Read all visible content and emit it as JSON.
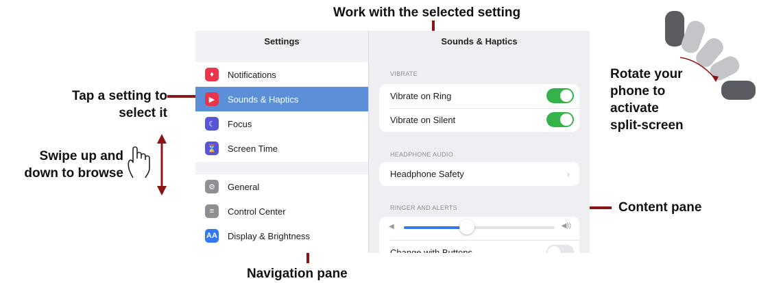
{
  "callouts": {
    "work": "Work with the selected setting",
    "tap_line1": "Tap a setting to",
    "tap_line2": "select it",
    "swipe_line1": "Swipe up and",
    "swipe_line2": "down to browse",
    "rotate_line1": "Rotate your",
    "rotate_line2": "phone to",
    "rotate_line3": "activate",
    "rotate_line4": "split-screen",
    "content": "Content pane",
    "navigation": "Navigation pane"
  },
  "nav": {
    "title": "Settings",
    "items": [
      {
        "label": "Notifications",
        "icon": "bell-icon",
        "color": "#e8354b",
        "selected": false
      },
      {
        "label": "Sounds & Haptics",
        "icon": "speaker-icon",
        "color": "#e8354b",
        "selected": true
      },
      {
        "label": "Focus",
        "icon": "moon-icon",
        "color": "#5856d6",
        "selected": false
      },
      {
        "label": "Screen Time",
        "icon": "hourglass-icon",
        "color": "#5856d6",
        "selected": false
      },
      {
        "label": "General",
        "icon": "gear-icon",
        "color": "#8e8e93",
        "selected": false
      },
      {
        "label": "Control Center",
        "icon": "switches-icon",
        "color": "#8e8e93",
        "selected": false
      },
      {
        "label": "Display & Brightness",
        "icon": "aa-icon",
        "color": "#3478f6",
        "selected": false
      }
    ]
  },
  "content": {
    "title": "Sounds & Haptics",
    "vibrate_header": "VIBRATE",
    "vibrate_on_ring": "Vibrate on Ring",
    "vibrate_on_silent": "Vibrate on Silent",
    "headphone_header": "HEADPHONE AUDIO",
    "headphone_safety": "Headphone Safety",
    "ringer_header": "RINGER AND ALERTS",
    "ringer_volume": 0.42,
    "change_with_buttons": "Change with Buttons"
  },
  "colors": {
    "callout_line": "#8c1414",
    "selected_row": "#5b8fd8",
    "toggle_on": "#36b24a"
  }
}
